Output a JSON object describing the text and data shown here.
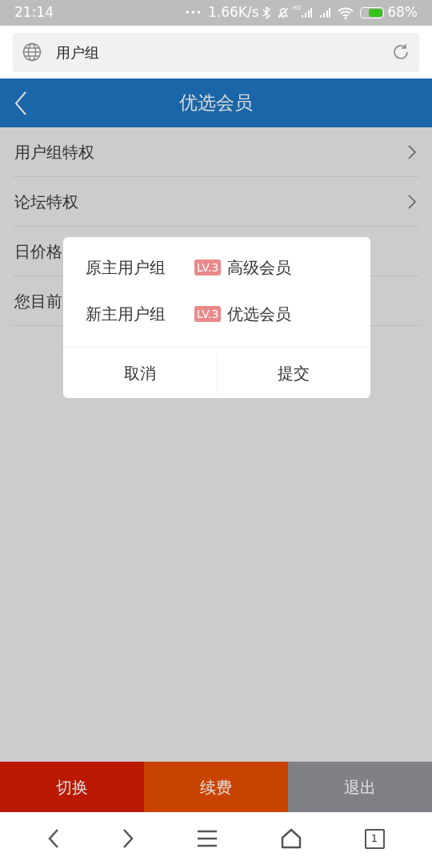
{
  "status_bar": {
    "time": "21:14",
    "dots": "•••",
    "speed": "1.66K/s",
    "hd": "HD",
    "battery": "68%"
  },
  "address_bar": {
    "value": "用户组"
  },
  "header": {
    "title": "优选会员"
  },
  "menu": [
    {
      "label": "用户组特权",
      "has_arrow": true
    },
    {
      "label": "论坛特权",
      "has_arrow": true
    },
    {
      "label": "日价格",
      "has_arrow": false
    },
    {
      "label": "您目前",
      "has_arrow": false
    }
  ],
  "dialog": {
    "rows": [
      {
        "label": "原主用户组",
        "badge": "LV.3",
        "value": "高级会员"
      },
      {
        "label": "新主用户组",
        "badge": "LV.3",
        "value": "优选会员"
      }
    ],
    "buttons": [
      "取消",
      "提交"
    ]
  },
  "actions": [
    {
      "label": "切换",
      "color": "#ba1800"
    },
    {
      "label": "续费",
      "color": "#c94300"
    },
    {
      "label": "退出",
      "color": "#7f8186"
    }
  ],
  "nav": {
    "tabs_count": "1"
  }
}
